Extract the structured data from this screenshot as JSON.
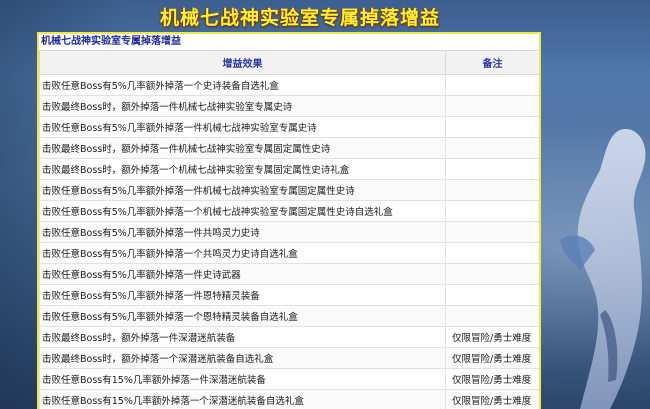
{
  "page": {
    "title": "机械七战神实验室专属掉落增益"
  },
  "panel": {
    "title": "机械七战神实验室专属掉落增益",
    "columns": [
      "增益效果",
      "备注"
    ],
    "rows": [
      {
        "effect": "击败任意Boss有5%几率额外掉落一个史诗装备自选礼盒",
        "note": ""
      },
      {
        "effect": "击败最终Boss时，额外掉落一件机械七战神实验室专属史诗",
        "note": ""
      },
      {
        "effect": "击败任意Boss有5%几率额外掉落一件机械七战神实验室专属史诗",
        "note": ""
      },
      {
        "effect": "击败最终Boss时，额外掉落一件机械七战神实验室专属固定属性史诗",
        "note": ""
      },
      {
        "effect": "击败最终Boss时，额外掉落一个机械七战神实验室专属固定属性史诗礼盒",
        "note": ""
      },
      {
        "effect": "击败任意Boss有5%几率额外掉落一件机械七战神实验室专属固定属性史诗",
        "note": ""
      },
      {
        "effect": "击败任意Boss有5%几率额外掉落一个机械七战神实验室专属固定属性史诗自选礼盒",
        "note": ""
      },
      {
        "effect": "击败任意Boss有5%几率额外掉落一件共鸣灵力史诗",
        "note": ""
      },
      {
        "effect": "击败任意Boss有5%几率额外掉落一个共鸣灵力史诗自选礼盒",
        "note": ""
      },
      {
        "effect": "击败任意Boss有5%几率额外掉落一件史诗武器",
        "note": ""
      },
      {
        "effect": "击败任意Boss有5%几率额外掉落一件恩特精灵装备",
        "note": ""
      },
      {
        "effect": "击败任意Boss有5%几率额外掉落一个恩特精灵装备自选礼盒",
        "note": ""
      },
      {
        "effect": "击败最终Boss时，额外掉落一件深潜迷航装备",
        "note": "仅限冒险/勇士难度"
      },
      {
        "effect": "击败最终Boss时，额外掉落一个深潜迷航装备自选礼盒",
        "note": "仅限冒险/勇士难度"
      },
      {
        "effect": "击败任意Boss有15%几率额外掉落一件深潜迷航装备",
        "note": "仅限冒险/勇士难度"
      },
      {
        "effect": "击败任意Boss有15%几率额外掉落一个深潜迷航装备自选礼盒",
        "note": "仅限冒险/勇士难度"
      }
    ]
  },
  "colors": {
    "title_yellow": "#ffef36",
    "panel_border": "#f0e64a",
    "header_text": "#2a35a8"
  }
}
